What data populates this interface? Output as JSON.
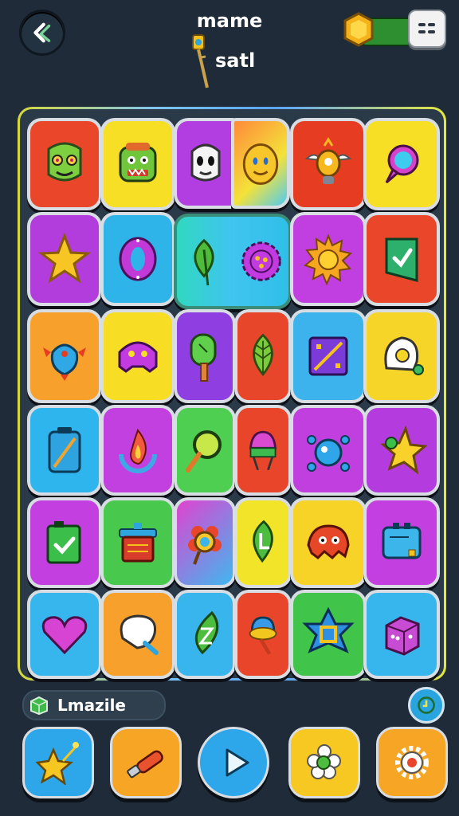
{
  "header": {
    "title": "mame",
    "subtitle": "satl"
  },
  "footer": {
    "label": "Lmazile"
  },
  "colors": {
    "background": "#1f2b38",
    "board": "#2b3a49",
    "red": "#e8452a",
    "yellow": "#f8d31e",
    "purple": "#b445d8",
    "blue": "#32b0e8",
    "green": "#3bc04a",
    "orange": "#f59b2b",
    "magenta": "#e04bd0"
  },
  "board": {
    "rows": [
      [
        "zombie-face-icon",
        "goblin-face-icon",
        "ghost-face-icon",
        "smile-face-icon",
        "robot-bird-icon",
        "speech-bubble-icon"
      ],
      [
        "star-icon",
        "ring-icon",
        "leaf-icon",
        "gear-flower-icon",
        "sun-icon",
        "check-flag-icon"
      ],
      [
        "fish-icon",
        "critter-icon",
        "popsicle-icon",
        "leaf-icon",
        "slash-box-icon",
        "egg-icon"
      ],
      [
        "battery-icon",
        "flame-icon",
        "magnifier-icon",
        "cupcake-icon",
        "bug-icon",
        "star-icon"
      ],
      [
        "check-bag-icon",
        "chest-icon",
        "flower-icon",
        "leaf-letter-icon",
        "blob-icon",
        "tv-icon"
      ],
      [
        "heart-icon",
        "tooth-icon",
        "leaf-letter-icon",
        "ice-cream-icon",
        "star-frame-icon",
        "cube-icon"
      ]
    ]
  },
  "toolbar": {
    "buttons": [
      "star-wand-icon",
      "brush-icon",
      "play-icon",
      "flower-gear-icon",
      "gear-icon"
    ]
  }
}
